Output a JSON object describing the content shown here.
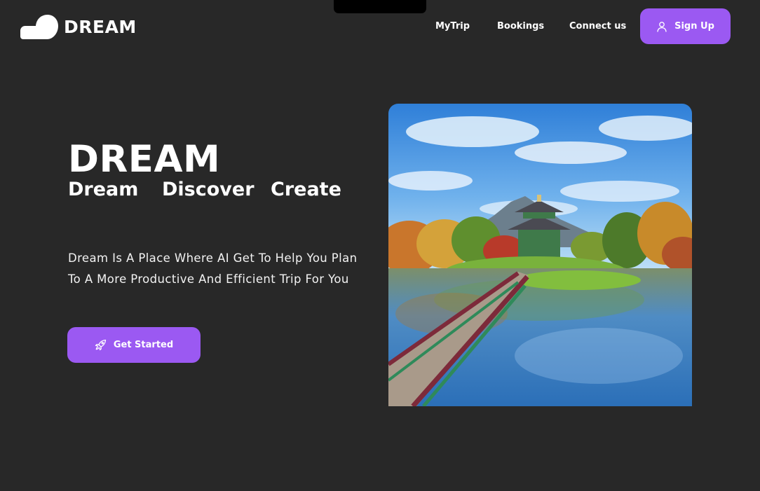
{
  "header": {
    "logo_text": "DREAM",
    "logo_icon": "cloud-icon",
    "nav": [
      {
        "label": "MyTrip"
      },
      {
        "label": "Bookings"
      },
      {
        "label": "Connect us"
      }
    ],
    "signup": {
      "label": "Sign Up",
      "icon": "user-icon"
    }
  },
  "hero": {
    "title": "DREAM",
    "tagline": [
      "Dream",
      "Discover",
      "Create"
    ],
    "description": "Dream Is A Place Where AI Get To Help You Plan To A More Productive And Efficient Trip For You",
    "cta": {
      "label": "Get Started",
      "icon": "rocket-icon"
    },
    "image": {
      "subject": "traditional pavilion on an island with a wooden bridge over a reflecting lake, autumn trees, mountain and blue sky"
    }
  },
  "colors": {
    "background": "#282828",
    "accent": "#9b59f2",
    "text": "#ffffff"
  }
}
